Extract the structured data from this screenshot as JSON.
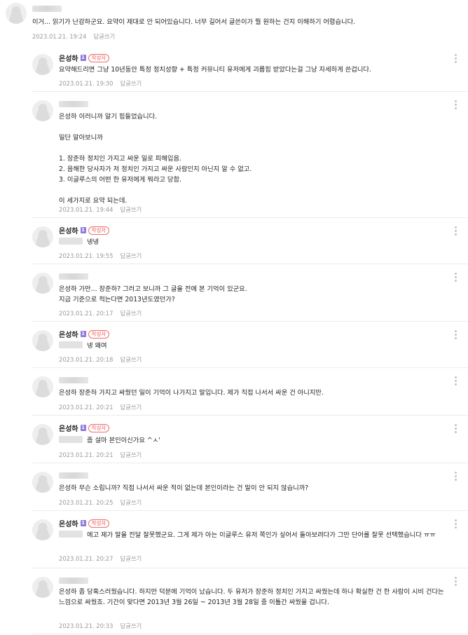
{
  "thread": {
    "comments": [
      {
        "author": "",
        "is_writer": false,
        "text": "이거... 읽기가 난감하군요. 요약이 제대로 안 되어있습니다. 너무 길어서 글쓴이가 뭘 원하는 건지 이해하기 어렵습니다.",
        "date": "2023.01.21. 19:24",
        "reply_label": "답글쓰기"
      },
      {
        "author": "은성하",
        "level": "1",
        "is_writer": true,
        "writer_badge": "작성자",
        "text": "요약해드리면 그냥 10년동안 특정 정치성향 + 특정 커뮤니티 유저에게 괴롭힘 받았다는걸 그냥 자세하게 쓴겁니다.",
        "date": "2023.01.21. 19:30",
        "reply_label": "답글쓰기"
      },
      {
        "author": "",
        "is_writer": false,
        "text": "은성하 이러니까 알기 힘들었습니다.\n\n일단 알아보니까\n\n1. 장준하 정치인 가지고 싸운 일로 피해입음.\n2. 음해한 당사자가 저 정치인 가지고 싸운 사람인지 아닌지 알 수 없고.\n3. 이글루스의 어떤 한 유저에게 뭐라고 당함.\n\n이 세가지로 요약 되는데.",
        "date": "2023.01.21. 19:44",
        "reply_label": "답글쓰기"
      },
      {
        "author": "은성하",
        "level": "1",
        "is_writer": true,
        "writer_badge": "작성자",
        "text": "넹넹",
        "date": "2023.01.21. 19:55",
        "reply_label": "답글쓰기"
      },
      {
        "author": "",
        "is_writer": false,
        "text": "은성하 가만... 장준하? 그러고 보니까 그 글을 전에 본 기억이 있군요.\n지금 기준으로 적는다면 2013년도였던가?",
        "date": "2023.01.21. 20:17",
        "reply_label": "답글쓰기"
      },
      {
        "author": "은성하",
        "level": "1",
        "is_writer": true,
        "writer_badge": "작성자",
        "text": "넹 왜여",
        "date": "2023.01.21. 20:18",
        "reply_label": "답글쓰기"
      },
      {
        "author": "",
        "is_writer": false,
        "text": "은성하 장준하 가지고 싸웠던 일이 기억이 나가지고 말입니다. 제가 직접 나서서 싸운 건 아니지만.",
        "date": "2023.01.21. 20:21",
        "reply_label": "답글쓰기"
      },
      {
        "author": "은성하",
        "level": "1",
        "is_writer": true,
        "writer_badge": "작성자",
        "text": "좀 설마 본인이신가요 ^ㅅ'",
        "date": "2023.01.21. 20:21",
        "reply_label": "답글쓰기"
      },
      {
        "author": "",
        "is_writer": false,
        "text": "은성하 무슨 소립니까? 직접 나서서 싸운 적이 없는데 본인이라는 건 말이 안 되지 않습니까?",
        "date": "2023.01.21. 20:25",
        "reply_label": "답글쓰기"
      },
      {
        "author": "은성하",
        "level": "1",
        "is_writer": true,
        "writer_badge": "작성자",
        "text": "에고 제가 말을 전달 잘못했군요. 그게 제가 아는 이글루스 유저 쪽인가 싶어서 돌아보려다가 그만 단어를 잘못 선택했습니다 ㅠㅠ",
        "date": "2023.01.21. 20:27",
        "reply_label": "답글쓰기"
      },
      {
        "author": "",
        "is_writer": false,
        "text": "은성하 좀 당혹스러웠습니다. 하지만 덕분에 기억이 났습니다. 두 유저가 장준하 정치인 가지고 싸웠는데 하나 확실한 건 한 사람이 시비 건다는 느낌으로 싸웠죠. 기간이 맞다면 2013년 3월 26일 ~ 2013년 3월 28일 중 이틀간 싸웠을 겁니다.",
        "date": "2023.01.21. 20:33",
        "reply_label": "답글쓰기"
      }
    ]
  }
}
